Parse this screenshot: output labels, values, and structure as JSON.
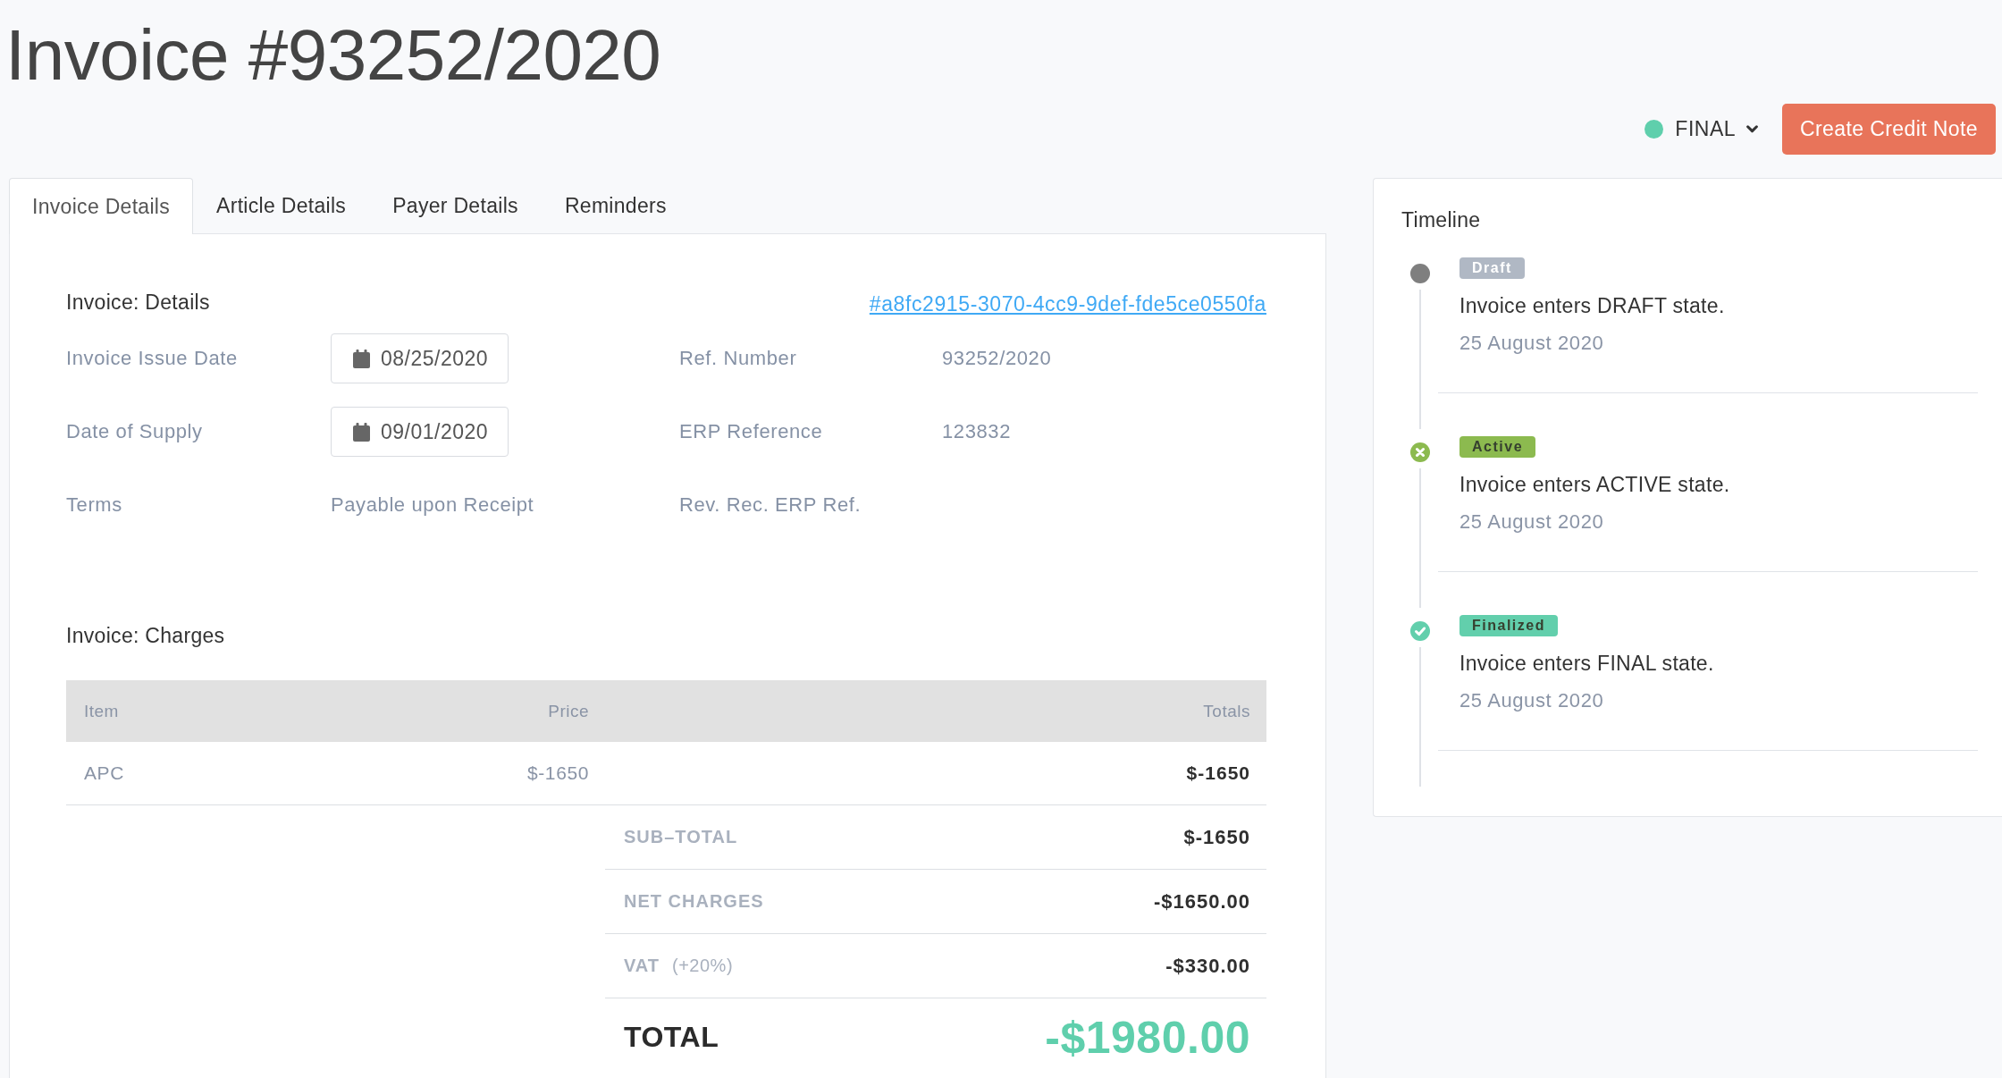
{
  "header": {
    "title": "Invoice #93252/2020",
    "status": {
      "label": "FINAL",
      "color": "#5fcfac"
    },
    "action_button": "Create Credit Note"
  },
  "tabs": [
    {
      "label": "Invoice Details",
      "selected": true
    },
    {
      "label": "Article Details",
      "selected": false
    },
    {
      "label": "Payer Details",
      "selected": false
    },
    {
      "label": "Reminders",
      "selected": false
    }
  ],
  "details": {
    "heading": "Invoice: Details",
    "link": "#a8fc2915-3070-4cc9-9def-fde5ce0550fa",
    "rows": [
      [
        {
          "label": "Invoice Issue Date",
          "value": "08/25/2020",
          "kind": "date"
        },
        {
          "label": "Ref. Number",
          "value": "93252/2020",
          "kind": "text"
        }
      ],
      [
        {
          "label": "Date of Supply",
          "value": "09/01/2020",
          "kind": "date"
        },
        {
          "label": "ERP Reference",
          "value": "123832",
          "kind": "text"
        }
      ],
      [
        {
          "label": "Terms",
          "value": "Payable upon Receipt",
          "kind": "text"
        },
        {
          "label": "Rev. Rec. ERP Ref.",
          "kind": "text"
        }
      ]
    ]
  },
  "charges": {
    "heading": "Invoice: Charges",
    "columns": [
      "Item",
      "Price",
      "Totals"
    ],
    "rows": [
      {
        "item": "APC",
        "price": "$-1650",
        "total": "$-1650"
      }
    ],
    "summary": [
      {
        "label": "SUB–TOTAL",
        "value": "$-1650",
        "kind": "line"
      },
      {
        "label": "NET CHARGES",
        "value": "-$1650.00",
        "kind": "line"
      },
      {
        "label": "VAT",
        "note": "(+20%)",
        "value": "-$330.00",
        "kind": "line"
      },
      {
        "label": "TOTAL",
        "value": "-$1980.00",
        "kind": "total"
      }
    ]
  },
  "timeline": {
    "title": "Timeline",
    "events": [
      {
        "kind": "draft",
        "badge": "Draft",
        "color": "#b0b8c4",
        "text": "Invoice enters DRAFT state.",
        "date": "25 August 2020"
      },
      {
        "kind": "active",
        "badge": "Active",
        "color": "#8cba4f",
        "text": "Invoice enters ACTIVE state.",
        "date": "25 August 2020"
      },
      {
        "kind": "finalized",
        "badge": "Finalized",
        "color": "#62cfac",
        "text": "Invoice enters FINAL state.",
        "date": "25 August 2020"
      }
    ]
  }
}
